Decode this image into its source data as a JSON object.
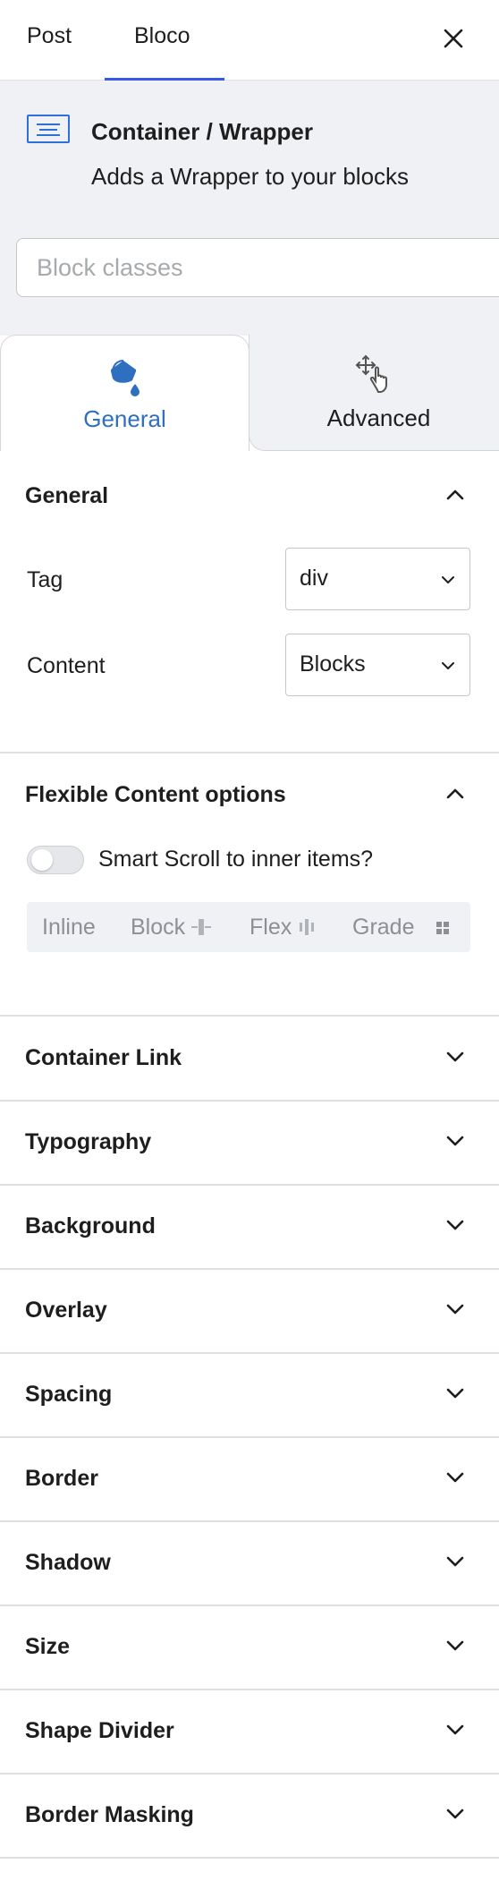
{
  "topbar": {
    "tabs": [
      "Post",
      "Bloco"
    ],
    "active_tab": "Bloco",
    "close_icon": "close-icon"
  },
  "block": {
    "icon": "container-icon",
    "title": "Container / Wrapper",
    "description": "Adds a Wrapper to your blocks"
  },
  "classes": {
    "placeholder": "Block classes"
  },
  "inspector_tabs": [
    {
      "label": "General",
      "icon": "paint-bucket-icon",
      "active": true
    },
    {
      "label": "Advanced",
      "icon": "move-pointer-icon",
      "active": false
    }
  ],
  "general": {
    "title": "General",
    "tag": {
      "label": "Tag",
      "value": "div"
    },
    "content": {
      "label": "Content",
      "value": "Blocks"
    }
  },
  "flex": {
    "title": "Flexible Content options",
    "smart_scroll_label": "Smart Scroll to inner items?",
    "smart_scroll_on": false,
    "display_options": [
      "Inline",
      "Block",
      "Flex",
      "Grade"
    ]
  },
  "panels": [
    "Container Link",
    "Typography",
    "Background",
    "Overlay",
    "Spacing",
    "Border",
    "Shadow",
    "Size",
    "Shape Divider",
    "Border Masking"
  ],
  "colors": {
    "accent": "#3858e9",
    "brand_blue": "#2f6fbf",
    "panel_bg": "#f0f1f5"
  }
}
